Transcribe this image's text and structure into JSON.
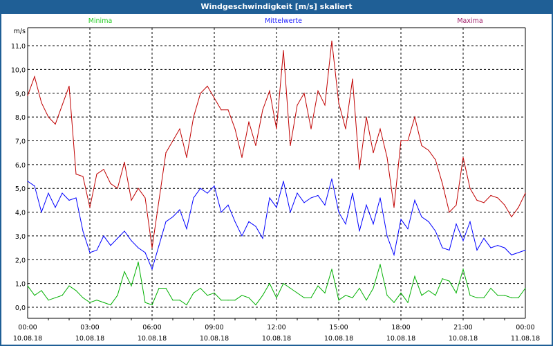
{
  "window": {
    "title": "Windgeschwindigkeit [m/s] skaliert"
  },
  "chart_data": {
    "type": "line",
    "title": "Windgeschwindigkeit [m/s] skaliert",
    "ylabel": "m/s",
    "ylim": [
      -0.5,
      12.0
    ],
    "yticks": [
      "0,0",
      "1,0",
      "2,0",
      "3,0",
      "4,0",
      "5,0",
      "6,0",
      "7,0",
      "8,0",
      "9,0",
      "10,0",
      "11,0"
    ],
    "xrange": [
      "10.08.18 00:00",
      "11.08.18 00:00"
    ],
    "xticks": [
      {
        "time": "00:00",
        "date": "10.08.18"
      },
      {
        "time": "03:00",
        "date": "10.08.18"
      },
      {
        "time": "06:00",
        "date": "10.08.18"
      },
      {
        "time": "09:00",
        "date": "10.08.18"
      },
      {
        "time": "12:00",
        "date": "10.08.18"
      },
      {
        "time": "15:00",
        "date": "10.08.18"
      },
      {
        "time": "18:00",
        "date": "10.08.18"
      },
      {
        "time": "21:00",
        "date": "10.08.18"
      },
      {
        "time": "00:00",
        "date": "11.08.18"
      }
    ],
    "sample_interval_minutes": 20,
    "grid": true,
    "legend_placement": "top",
    "series": [
      {
        "name": "Minima",
        "legend_color": "#22cc22",
        "line_color": "#00b000",
        "values": [
          0.9,
          0.5,
          0.7,
          0.3,
          0.4,
          0.5,
          0.9,
          0.7,
          0.4,
          0.2,
          0.3,
          0.2,
          0.1,
          0.5,
          1.5,
          0.9,
          1.9,
          0.2,
          0.1,
          0.8,
          0.8,
          0.3,
          0.3,
          0.1,
          0.6,
          0.8,
          0.5,
          0.6,
          0.3,
          0.3,
          0.3,
          0.5,
          0.4,
          0.1,
          0.5,
          1.0,
          0.4,
          1.0,
          0.8,
          0.6,
          0.4,
          0.4,
          0.9,
          0.6,
          1.6,
          0.3,
          0.5,
          0.4,
          0.8,
          0.3,
          0.8,
          1.8,
          0.5,
          0.2,
          0.6,
          0.2,
          1.3,
          0.5,
          0.7,
          0.5,
          1.2,
          1.1,
          0.6,
          1.6,
          0.5,
          0.4,
          0.4,
          0.8,
          0.5,
          0.5,
          0.4,
          0.4,
          0.8
        ]
      },
      {
        "name": "Mittelwerte",
        "legend_color": "#2020ff",
        "line_color": "#0000ff",
        "values": [
          5.3,
          5.1,
          4.0,
          4.8,
          4.2,
          4.8,
          4.5,
          4.6,
          3.2,
          2.3,
          2.4,
          3.0,
          2.6,
          2.9,
          3.2,
          2.8,
          2.5,
          2.3,
          1.6,
          2.6,
          3.6,
          3.8,
          4.1,
          3.3,
          4.6,
          5.0,
          4.8,
          5.1,
          4.0,
          4.3,
          3.6,
          3.0,
          3.6,
          3.4,
          2.9,
          4.6,
          4.2,
          5.3,
          4.0,
          4.8,
          4.4,
          4.6,
          4.7,
          4.3,
          5.4,
          4.0,
          3.5,
          4.8,
          3.2,
          4.3,
          3.5,
          4.6,
          3.0,
          2.2,
          3.7,
          3.3,
          4.5,
          3.8,
          3.6,
          3.2,
          2.5,
          2.4,
          3.5,
          2.8,
          3.6,
          2.4,
          2.9,
          2.5,
          2.6,
          2.5,
          2.2,
          2.3,
          2.4
        ]
      },
      {
        "name": "Maxima",
        "legend_color": "#a0206a",
        "line_color": "#c00000",
        "values": [
          8.9,
          9.7,
          8.6,
          8.0,
          7.7,
          8.5,
          9.3,
          5.6,
          5.5,
          4.2,
          5.6,
          5.8,
          5.2,
          5.0,
          6.1,
          4.5,
          5.0,
          4.6,
          2.5,
          4.5,
          6.5,
          7.0,
          7.5,
          6.3,
          8.0,
          9.0,
          9.3,
          8.8,
          8.3,
          8.3,
          7.5,
          6.3,
          7.8,
          6.8,
          8.3,
          9.1,
          7.5,
          10.8,
          6.8,
          8.5,
          9.0,
          7.5,
          9.1,
          8.5,
          11.2,
          8.6,
          7.5,
          9.6,
          5.8,
          8.0,
          6.5,
          7.5,
          6.3,
          4.2,
          7.0,
          7.0,
          8.0,
          6.8,
          6.6,
          6.2,
          5.2,
          4.0,
          4.3,
          6.3,
          5.0,
          4.5,
          4.4,
          4.7,
          4.6,
          4.3,
          3.8,
          4.2,
          4.8
        ]
      }
    ]
  }
}
